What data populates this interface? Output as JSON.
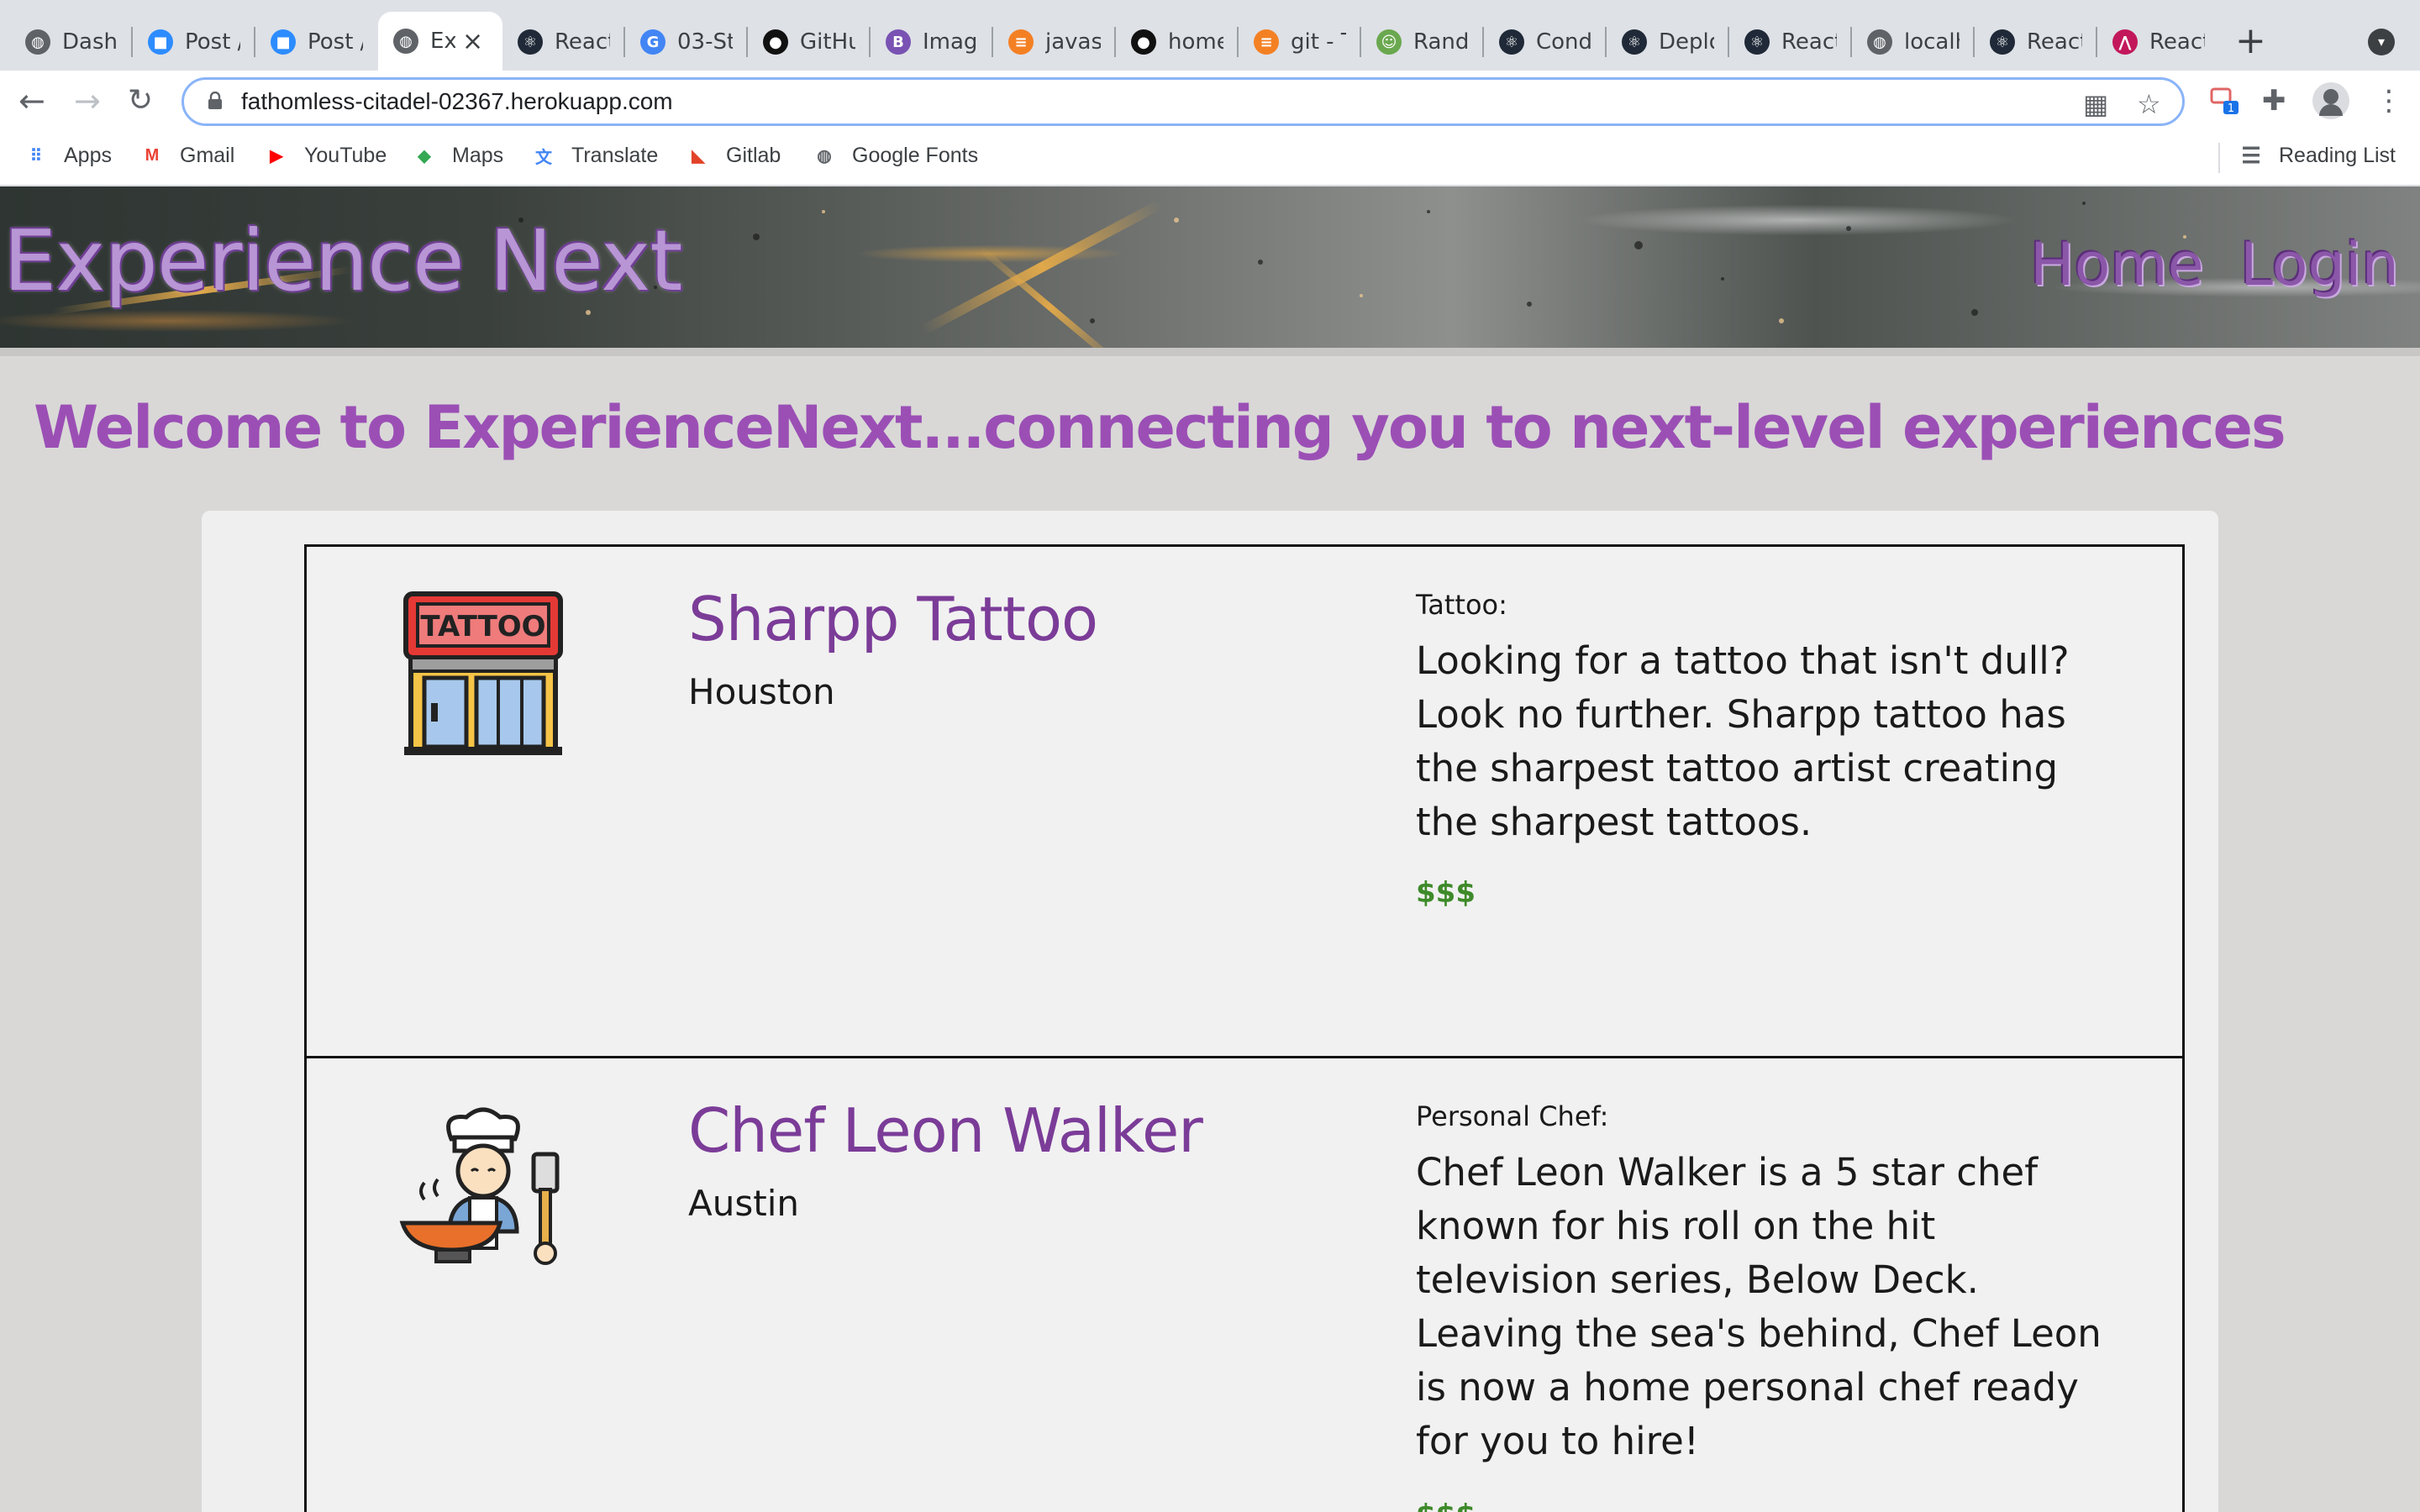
{
  "browser": {
    "tabs": [
      {
        "label": "Dashb",
        "icon": "globe-icon",
        "color": "#5f6368"
      },
      {
        "label": "Post /",
        "icon": "zoom-icon",
        "color": "#2d8cff"
      },
      {
        "label": "Post /",
        "icon": "zoom-icon",
        "color": "#2d8cff"
      },
      {
        "label": "Ex",
        "icon": "globe-icon",
        "color": "#5f6368",
        "active": true
      },
      {
        "label": "React",
        "icon": "react-icon",
        "color": "#1f2937"
      },
      {
        "label": "03-St",
        "icon": "google-icon",
        "color": "#4285f4"
      },
      {
        "label": "GitHu",
        "icon": "github-icon",
        "color": "#111111"
      },
      {
        "label": "Image",
        "icon": "bootstrap-icon",
        "color": "#7952b3"
      },
      {
        "label": "javas",
        "icon": "stackoverflow-icon",
        "color": "#f48024"
      },
      {
        "label": "home",
        "icon": "github-icon",
        "color": "#111111"
      },
      {
        "label": "git - T",
        "icon": "stackoverflow-icon",
        "color": "#f48024"
      },
      {
        "label": "Rando",
        "icon": "random-icon",
        "color": "#6aa84f"
      },
      {
        "label": "Condi",
        "icon": "react-icon",
        "color": "#1f2937"
      },
      {
        "label": "Deplo",
        "icon": "react-icon",
        "color": "#1f2937"
      },
      {
        "label": "React",
        "icon": "react-icon",
        "color": "#1f2937"
      },
      {
        "label": "localh",
        "icon": "globe-icon",
        "color": "#5f6368"
      },
      {
        "label": "React",
        "icon": "react-icon",
        "color": "#1f2937"
      },
      {
        "label": "React",
        "icon": "graph-icon",
        "color": "#c2185b"
      }
    ],
    "url": "fathomless-citadel-02367.herokuapp.com",
    "extension_badge": "1",
    "bookmarks": [
      {
        "label": "Apps",
        "icon": "apps-grid-icon",
        "color": "#4285f4"
      },
      {
        "label": "Gmail",
        "icon": "gmail-icon",
        "color": "#ea4335"
      },
      {
        "label": "YouTube",
        "icon": "youtube-icon",
        "color": "#ff0000"
      },
      {
        "label": "Maps",
        "icon": "maps-icon",
        "color": "#34a853"
      },
      {
        "label": "Translate",
        "icon": "translate-icon",
        "color": "#4285f4"
      },
      {
        "label": "Gitlab",
        "icon": "gitlab-icon",
        "color": "#e24329"
      },
      {
        "label": "Google Fonts",
        "icon": "globe-icon",
        "color": "#5f6368"
      }
    ],
    "reading_list": "Reading List"
  },
  "site": {
    "brand": "Experience Next",
    "nav": {
      "home": "Home",
      "login": "Login"
    },
    "welcome": "Welcome to ExperienceNext...connecting you to next-level experiences",
    "accent": "#9b4fb5"
  },
  "listings": [
    {
      "name": "Sharpp Tattoo",
      "city": "Houston",
      "category": "Tattoo:",
      "description": "Looking for a tattoo that isn't dull? Look no further. Sharpp tattoo has the sharpest tattoo artist creating the sharpest tattoos.",
      "price": "$$$",
      "icon": "tattoo-shop-icon",
      "sign_text": "TATTOO"
    },
    {
      "name": "Chef Leon Walker",
      "city": "Austin",
      "category": "Personal Chef:",
      "description": "Chef Leon Walker is a 5 star chef known for his roll on the hit television series, Below Deck. Leaving the sea's behind, Chef Leon is now a home personal chef ready for you to hire!",
      "price": "$$$",
      "icon": "chef-icon"
    }
  ]
}
